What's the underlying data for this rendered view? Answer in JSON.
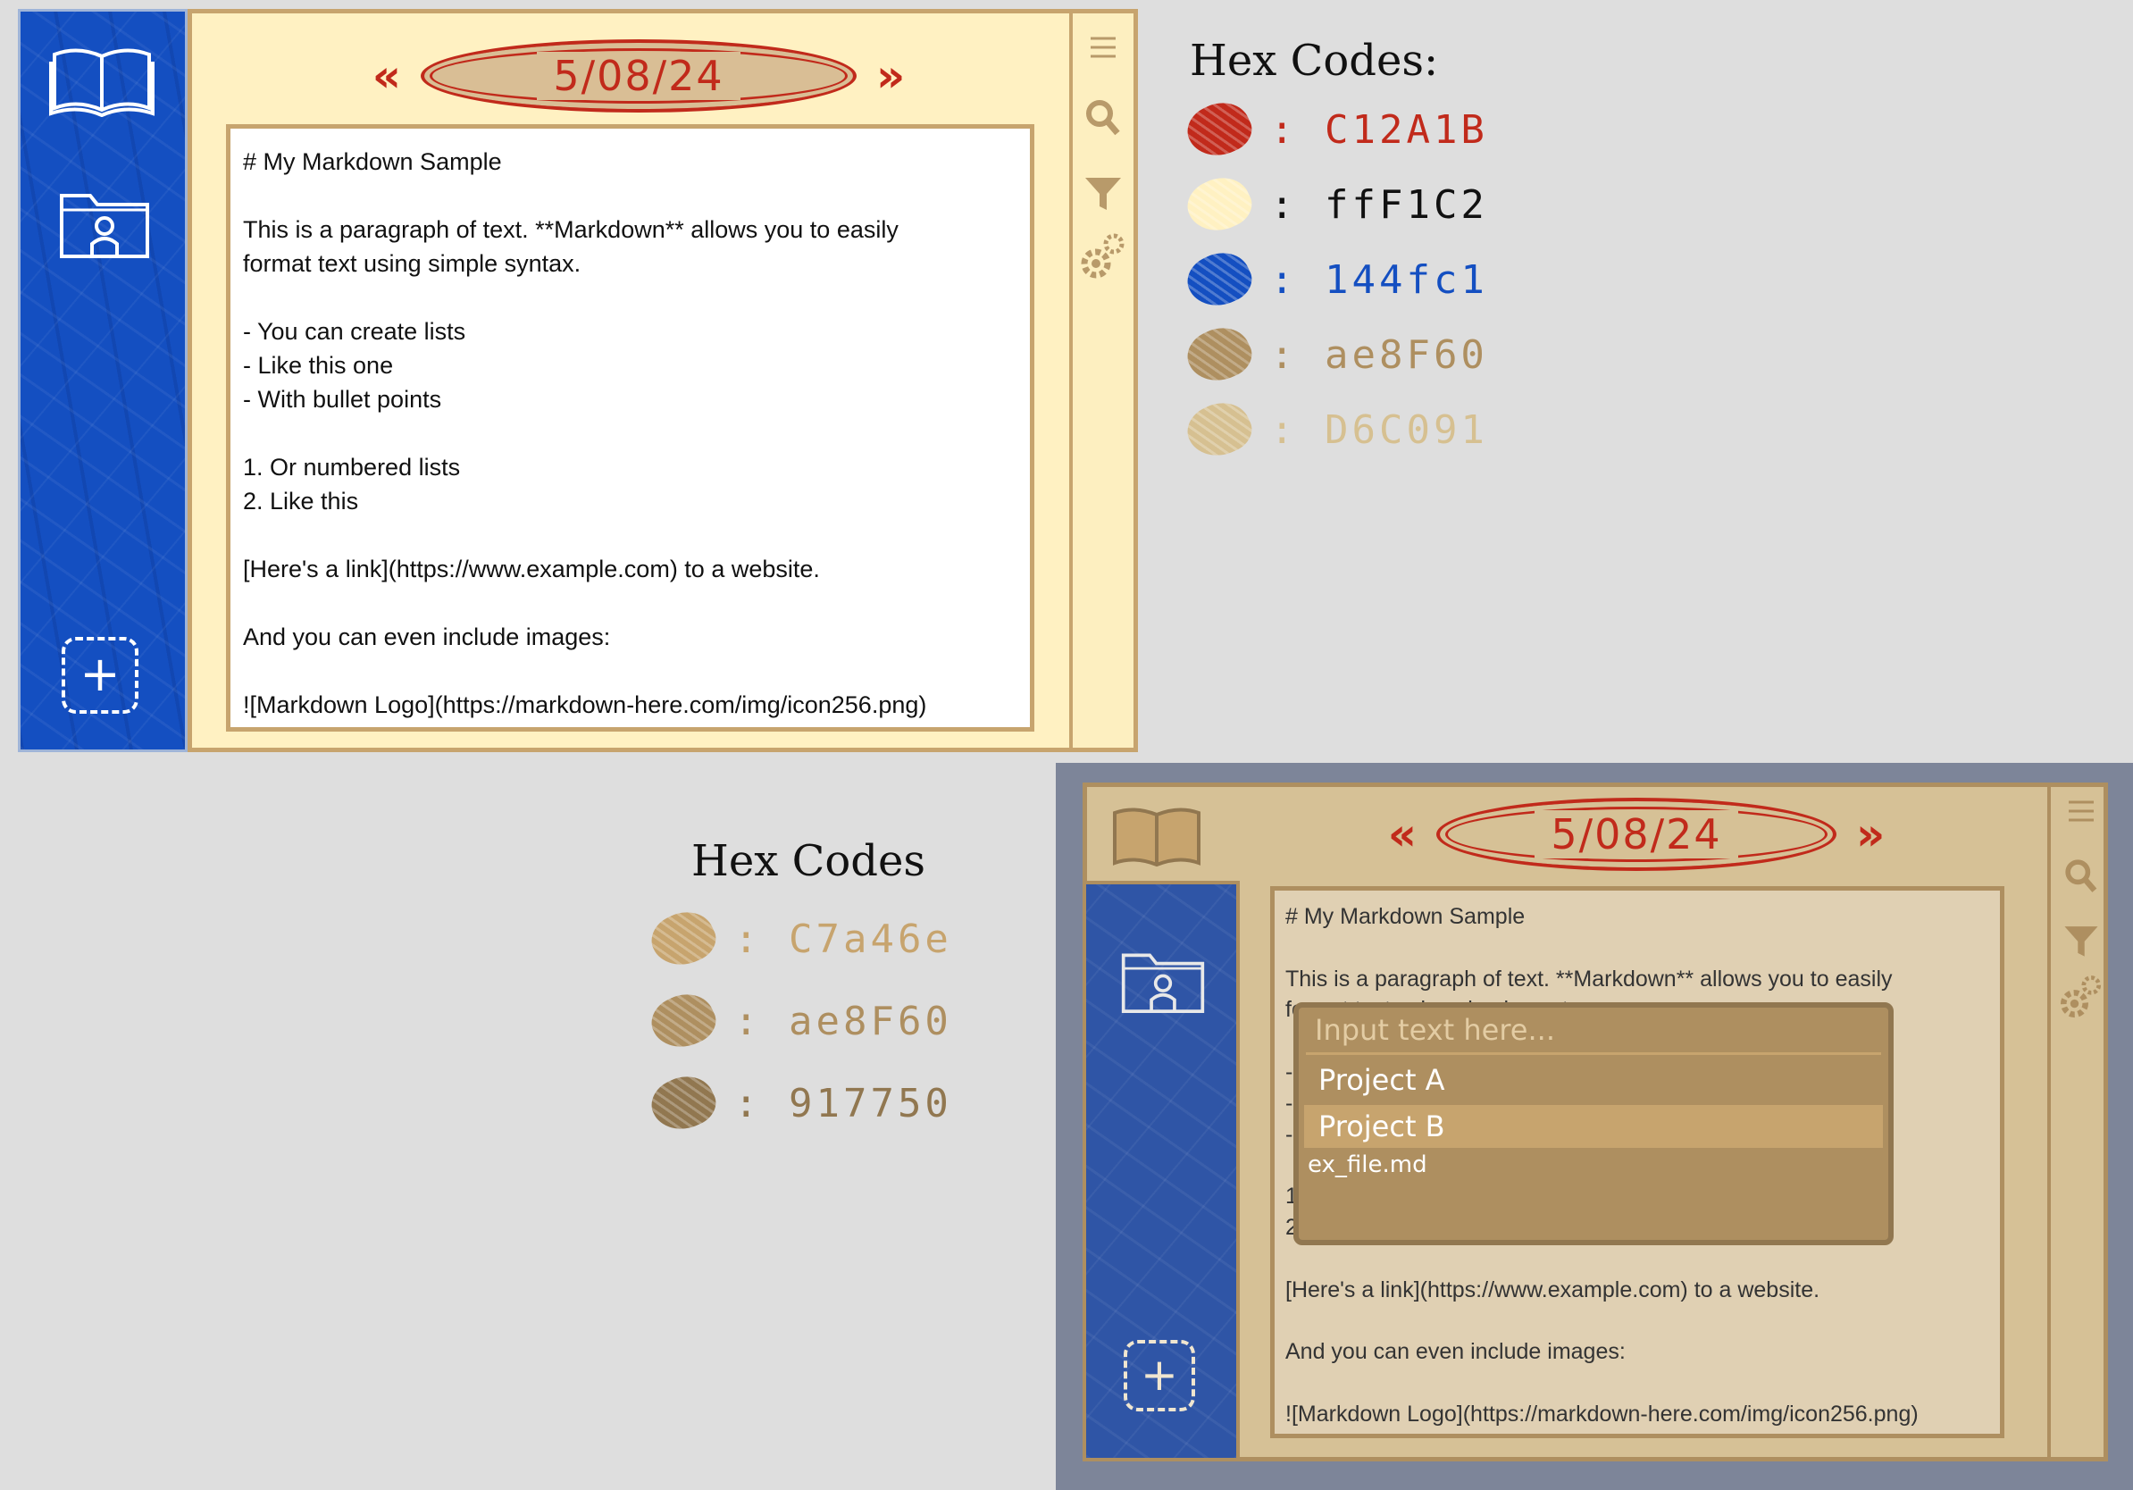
{
  "mockup_light": {
    "date": "5/08/24",
    "chev_left": "«",
    "chev_right": "»",
    "doc_lines": [
      "# My Markdown Sample",
      "",
      "This is a paragraph of text. **Markdown** allows you to easily",
      "format text using simple syntax.",
      "",
      "- You can create lists",
      "- Like this one",
      "- With bullet points",
      "",
      "1. Or numbered lists",
      "2. Like this",
      "",
      "[Here's a link](https://www.example.com) to a website.",
      "",
      "And you can even include images:",
      "",
      "![Markdown Logo](https://markdown-here.com/img/icon256.png)"
    ],
    "icons": [
      "book-icon",
      "user-folder-icon",
      "add-icon",
      "menu-icon",
      "search-icon",
      "filter-icon",
      "settings-icon"
    ]
  },
  "hex_legend_1": {
    "title": "Hex Codes:",
    "items": [
      {
        "code": ": C12A1B",
        "color": "#c12a1b"
      },
      {
        "code": ": ffF1C2",
        "color": "#fff1c2"
      },
      {
        "code": ": 144fc1",
        "color": "#144fc1"
      },
      {
        "code": ": ae8F60",
        "color": "#ae8f60"
      },
      {
        "code": ": D6C091",
        "color": "#d6c091"
      }
    ]
  },
  "hex_legend_2": {
    "title": "Hex Codes",
    "items": [
      {
        "code": ": C7a46e",
        "color": "#c7a46e"
      },
      {
        "code": ": ae8F60",
        "color": "#ae8f60"
      },
      {
        "code": ": 917750",
        "color": "#917750"
      }
    ]
  },
  "mockup_dark": {
    "date": "5/08/24",
    "chev_left": "«",
    "chev_right": "»",
    "doc_lines": [
      "# My Markdown Sample",
      "",
      "This is a paragraph of text. **Markdown** allows you to easily",
      "format text using simple syntax.",
      "",
      "-",
      "-",
      "-",
      "",
      "1",
      "2",
      "",
      "[Here's a link](https://www.example.com) to a website.",
      "",
      "And you can even include images:",
      "",
      "![Markdown Logo](https://markdown-here.com/img/icon256.png)"
    ],
    "dropdown": {
      "placeholder": "Input text here...",
      "items": [
        "Project A",
        "Project B"
      ],
      "selected": "Project B",
      "file": "ex_file.md"
    }
  }
}
